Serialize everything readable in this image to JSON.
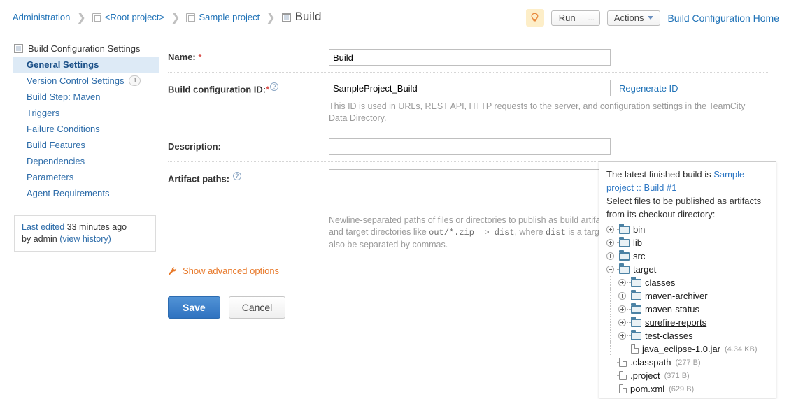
{
  "breadcrumb": {
    "items": [
      {
        "label": "Administration",
        "icon": "none"
      },
      {
        "label": "<Root project>",
        "icon": "project-icon"
      },
      {
        "label": "Sample project",
        "icon": "project-icon"
      },
      {
        "label": "Build",
        "icon": "build-icon"
      }
    ],
    "separator": "❯"
  },
  "toolbar": {
    "bulb_icon": "lightbulb-icon",
    "run_label": "Run",
    "run_dots_label": "...",
    "actions_label": "Actions",
    "home_link": "Build Configuration Home"
  },
  "sidebar": {
    "header": "Build Configuration Settings",
    "items": [
      {
        "label": "General Settings",
        "badge": "",
        "active": true
      },
      {
        "label": "Version Control Settings",
        "badge": "1",
        "active": false
      },
      {
        "label": "Build Step: Maven",
        "badge": "",
        "active": false
      },
      {
        "label": "Triggers",
        "badge": "",
        "active": false
      },
      {
        "label": "Failure Conditions",
        "badge": "",
        "active": false
      },
      {
        "label": "Build Features",
        "badge": "",
        "active": false
      },
      {
        "label": "Dependencies",
        "badge": "",
        "active": false
      },
      {
        "label": "Parameters",
        "badge": "",
        "active": false
      },
      {
        "label": "Agent Requirements",
        "badge": "",
        "active": false
      }
    ],
    "last_edited": {
      "prefix": "Last edited",
      "time": "33 minutes ago",
      "by": "by admin",
      "history_link": "(view history)"
    }
  },
  "form": {
    "name": {
      "label": "Name:",
      "required_mark": "*",
      "value": "Build",
      "placeholder": ""
    },
    "build_id": {
      "label": "Build configuration ID:",
      "required_mark": "*",
      "help_icon": "question-mark-icon",
      "value": "SampleProject_Build",
      "regenerate_link": "Regenerate ID",
      "hint": "This ID is used in URLs, REST API, HTTP requests to the server, and configuration settings in the TeamCity Data Directory."
    },
    "description": {
      "label": "Description:",
      "value": "",
      "placeholder": ""
    },
    "artifact_paths": {
      "label": "Artifact paths:",
      "help_icon": "question-mark-icon",
      "value": "",
      "hint_part1": "Newline-separated paths of files or directories to publish as build artifac",
      "hint_part2a": "and target directories like ",
      "hint_code1": "out/*.zip => dist",
      "hint_part2b": ", where ",
      "hint_code2": "dist",
      "hint_part2c": " is a target d",
      "hint_part3": "also be separated by commas."
    },
    "advanced_link": "Show advanced options",
    "advanced_icon": "wrench-icon",
    "save_label": "Save",
    "cancel_label": "Cancel"
  },
  "artifact_popup": {
    "intro_prefix": "The latest finished build is ",
    "intro_link": "Sample project :: Build #1",
    "instruction": "Select files to be published as artifacts from its checkout directory:",
    "tree": [
      {
        "name": "bin",
        "type": "folder",
        "state": "collapsed",
        "depth": 1,
        "size": ""
      },
      {
        "name": "lib",
        "type": "folder",
        "state": "collapsed",
        "depth": 1,
        "size": ""
      },
      {
        "name": "src",
        "type": "folder",
        "state": "collapsed",
        "depth": 1,
        "size": ""
      },
      {
        "name": "target",
        "type": "folder",
        "state": "expanded",
        "depth": 1,
        "size": ""
      },
      {
        "name": "classes",
        "type": "folder",
        "state": "collapsed",
        "depth": 2,
        "size": ""
      },
      {
        "name": "maven-archiver",
        "type": "folder",
        "state": "collapsed",
        "depth": 2,
        "size": ""
      },
      {
        "name": "maven-status",
        "type": "folder",
        "state": "collapsed",
        "depth": 2,
        "size": ""
      },
      {
        "name": "surefire-reports",
        "type": "folder",
        "state": "collapsed",
        "depth": 2,
        "size": "",
        "hovered": true
      },
      {
        "name": "test-classes",
        "type": "folder",
        "state": "collapsed",
        "depth": 2,
        "size": ""
      },
      {
        "name": "java_eclipse-1.0.jar",
        "type": "file",
        "state": "leaf",
        "depth": 2,
        "size": "(4.34 KB)"
      },
      {
        "name": ".classpath",
        "type": "file",
        "state": "leaf",
        "depth": 1,
        "size": "(277 B)"
      },
      {
        "name": ".project",
        "type": "file",
        "state": "leaf",
        "depth": 1,
        "size": "(371 B)"
      },
      {
        "name": "pom.xml",
        "type": "file",
        "state": "leaf",
        "depth": 1,
        "size": "(629 B)"
      }
    ]
  },
  "colors": {
    "link_blue": "#1f72b7",
    "sidebar_active_bg": "#ddeaf6",
    "save_button_blue": "#2f72c0",
    "advanced_orange": "#e8792a",
    "folder_icon": "#4c82a4",
    "required_red": "#d9534f"
  }
}
